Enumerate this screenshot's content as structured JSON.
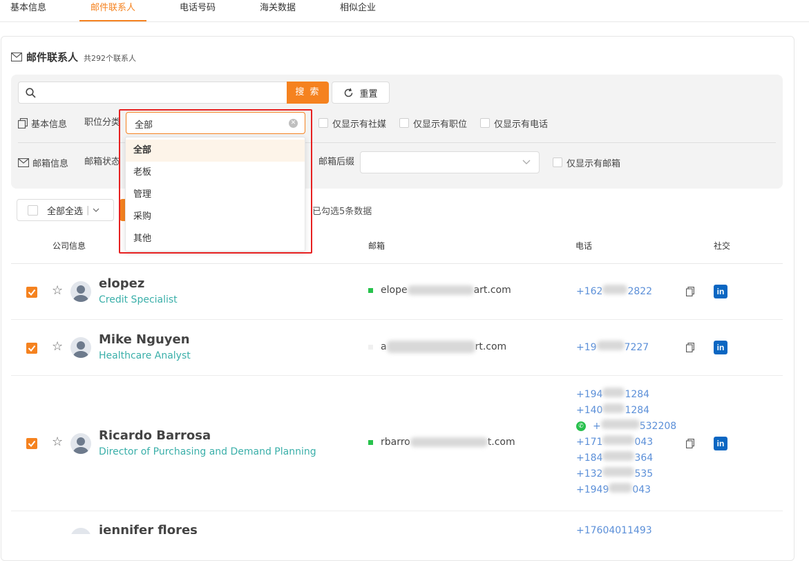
{
  "tabs": [
    {
      "label": "基本信息"
    },
    {
      "label": "邮件联系人"
    },
    {
      "label": "电话号码"
    },
    {
      "label": "海关数据"
    },
    {
      "label": "相似企业"
    }
  ],
  "section": {
    "title": "邮件联系人",
    "count_text": "共292个联系人"
  },
  "search": {
    "placeholder": "",
    "button_label": "搜 索",
    "reset_label": "重置"
  },
  "filters": {
    "basic_label": "基本信息",
    "position_label": "职位分类",
    "position_value": "全部",
    "only_social": "仅显示有社媒",
    "only_position": "仅显示有职位",
    "only_phone": "仅显示有电话",
    "mail_label": "邮箱信息",
    "mail_status_label": "邮箱状态",
    "mail_suffix_label": "邮箱后缀",
    "only_email": "仅显示有邮箱"
  },
  "dropdown": {
    "options": [
      "全部",
      "老板",
      "管理",
      "采购",
      "其他"
    ],
    "selected": "全部"
  },
  "selection": {
    "select_all_label": "全部全选",
    "selected_text": "已勾选5条数据"
  },
  "table": {
    "headers": {
      "company": "公司信息",
      "email": "邮箱",
      "phone": "电话",
      "social": "社交"
    },
    "rows": [
      {
        "name": "elopez",
        "title": "Credit Specialist",
        "email_start": "elope",
        "email_end": "art.com",
        "phones": [
          {
            "start": "+162",
            "end": "2822"
          }
        ]
      },
      {
        "name": "Mike Nguyen",
        "title": "Healthcare Analyst",
        "email_start": "a",
        "email_end": "rt.com",
        "phones": [
          {
            "start": "+19",
            "end": "7227"
          }
        ]
      },
      {
        "name": "Ricardo Barrosa",
        "title": "Director of Purchasing and Demand Planning",
        "email_start": "rbarro",
        "email_end": "t.com",
        "phones": [
          {
            "start": "+194",
            "end": "1284"
          },
          {
            "start": "+140",
            "end": "1284"
          },
          {
            "start": "+",
            "end": "532208"
          },
          {
            "start": "+171",
            "end": "043"
          },
          {
            "start": "+184",
            "end": "364"
          },
          {
            "start": "+132",
            "end": "535"
          },
          {
            "start": "+1949",
            "end": "043"
          }
        ]
      },
      {
        "name": "jennifer flores",
        "phones": [
          {
            "start": "+17604011493",
            "end": ""
          }
        ]
      }
    ]
  },
  "colors": {
    "accent": "#f5821f",
    "title_teal": "#3aafa9",
    "phone_blue": "#5b8fd8",
    "linkedin": "#0a66c2",
    "highlight_red": "#e62020"
  }
}
